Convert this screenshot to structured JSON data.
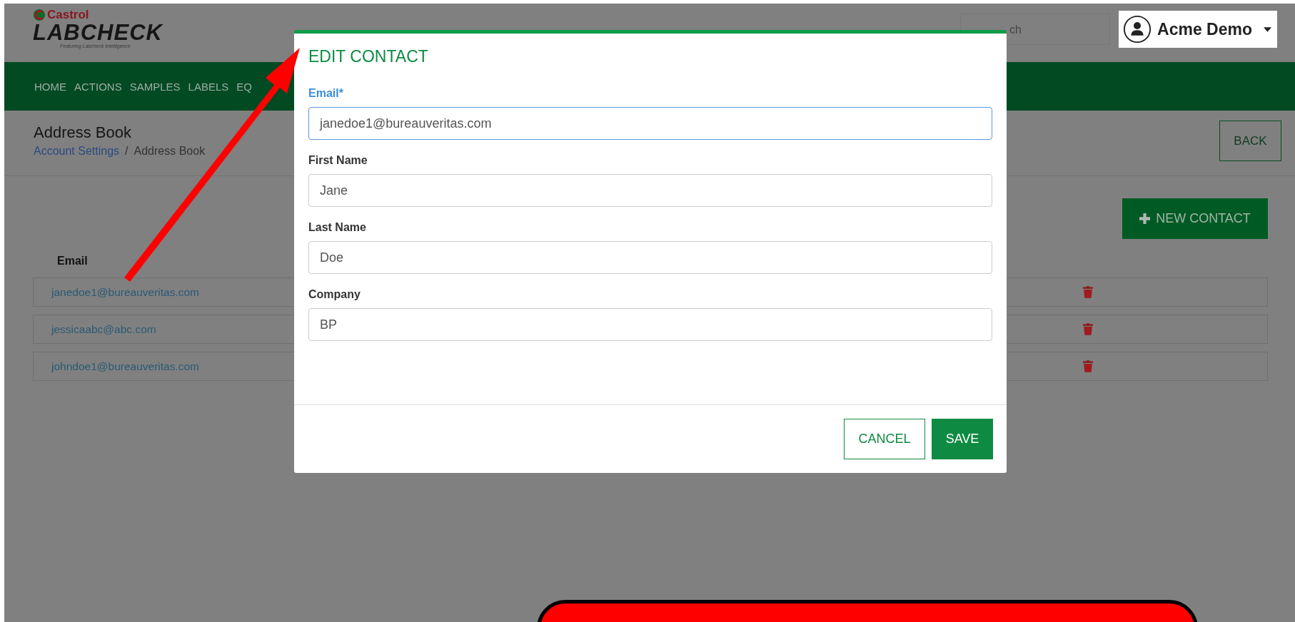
{
  "header": {
    "logo": {
      "brand": "Castrol",
      "product": "LABCHECK",
      "tagline": "Featuring Labcheck Intelligence"
    },
    "search": {
      "placeholder": "ch"
    },
    "account": {
      "name": "Acme Demo"
    }
  },
  "nav": [
    {
      "label": "HOME"
    },
    {
      "label": "ACTIONS"
    },
    {
      "label": "SAMPLES"
    },
    {
      "label": "LABELS"
    },
    {
      "label": "EQ"
    }
  ],
  "page": {
    "title": "Address Book",
    "breadcrumb": [
      {
        "label": "Account Settings",
        "kind": "link"
      },
      {
        "label": "/",
        "kind": "separator"
      },
      {
        "label": "Address Book",
        "kind": "current"
      }
    ],
    "back_button": "BACK",
    "new_contact_button": "NEW CONTACT"
  },
  "table": {
    "columns": [
      "Email"
    ],
    "rows": [
      {
        "email": "janedoe1@bureauveritas.com"
      },
      {
        "email": "jessicaabc@abc.com"
      },
      {
        "email": "johndoe1@bureauveritas.com"
      }
    ]
  },
  "modal": {
    "title": "EDIT CONTACT",
    "fields": [
      {
        "label": "Email*",
        "value": "janedoe1@bureauveritas.com",
        "focused": true
      },
      {
        "label": "First Name",
        "value": "Jane",
        "focused": false
      },
      {
        "label": "Last Name",
        "value": "Doe",
        "focused": false
      },
      {
        "label": "Company",
        "value": "BP",
        "focused": false
      }
    ],
    "buttons": [
      {
        "label": "CANCEL",
        "kind": "secondary"
      },
      {
        "label": "SAVE",
        "kind": "primary"
      }
    ]
  }
}
